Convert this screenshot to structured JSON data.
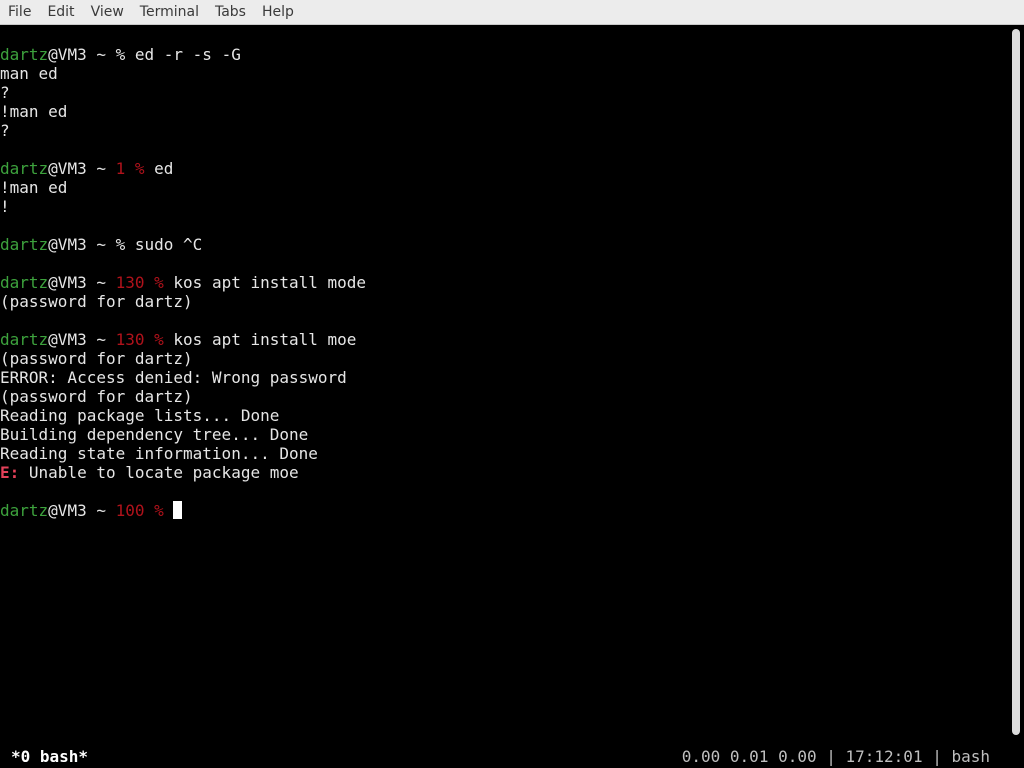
{
  "menubar": {
    "items": [
      "File",
      "Edit",
      "View",
      "Terminal",
      "Tabs",
      "Help"
    ]
  },
  "prompt": {
    "user": "dartz",
    "host": "@VM3 ~ "
  },
  "terminal": {
    "blocks": [
      {
        "type": "prompt",
        "status": "",
        "symbol": "% ",
        "command": "ed -r -s -G"
      },
      {
        "type": "out",
        "text": "man ed"
      },
      {
        "type": "out",
        "text": "?"
      },
      {
        "type": "out",
        "text": "!man ed"
      },
      {
        "type": "out",
        "text": "?"
      },
      {
        "type": "blank"
      },
      {
        "type": "prompt",
        "status": "1 ",
        "symbol": "% ",
        "command": "ed"
      },
      {
        "type": "out",
        "text": "!man ed"
      },
      {
        "type": "out",
        "text": "!"
      },
      {
        "type": "blank"
      },
      {
        "type": "prompt",
        "status": "",
        "symbol": "% ",
        "command": "sudo ^C"
      },
      {
        "type": "blank"
      },
      {
        "type": "prompt",
        "status": "130 ",
        "symbol": "% ",
        "command": "kos apt install mode"
      },
      {
        "type": "out",
        "text": "(password for dartz)"
      },
      {
        "type": "blank"
      },
      {
        "type": "prompt",
        "status": "130 ",
        "symbol": "% ",
        "command": "kos apt install moe"
      },
      {
        "type": "out",
        "text": "(password for dartz)"
      },
      {
        "type": "out",
        "text": "ERROR: Access denied: Wrong password"
      },
      {
        "type": "out",
        "text": "(password for dartz)"
      },
      {
        "type": "out",
        "text": "Reading package lists... Done"
      },
      {
        "type": "out",
        "text": "Building dependency tree... Done"
      },
      {
        "type": "out",
        "text": "Reading state information... Done"
      },
      {
        "type": "error",
        "prefix": "E:",
        "text": " Unable to locate package moe"
      },
      {
        "type": "blank"
      },
      {
        "type": "prompt",
        "status": "100 ",
        "symbol": "% ",
        "command": "",
        "cursor": true
      }
    ]
  },
  "statusbar": {
    "window": "*0 bash*",
    "right": "0.00 0.01 0.00 | 17:12:01 | bash"
  },
  "colors": {
    "user": "#3da23d",
    "exit_status": "#b0121b",
    "error_prefix": "#e4415a",
    "background": "#000000"
  }
}
